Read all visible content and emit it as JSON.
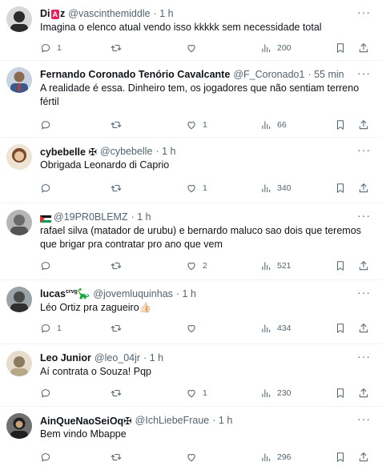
{
  "tweets": [
    {
      "name_pre": "Di",
      "name_badge": "A",
      "name_post": "z",
      "handle": "@vascinthemiddle",
      "time": "· 1 h",
      "text": "Imagina o elenco atual vendo isso kkkkk sem necessidade total",
      "replies": "1",
      "retweets": "",
      "likes": "",
      "views": "200",
      "avatar_color": "#2b2b2b"
    },
    {
      "name": "Fernando Coronado Tenório Cavalcante",
      "handle": "@F_Coronado1",
      "time": "· 55 min",
      "text": "A realidade é essa. Dinheiro tem, os jogadores que não sentiam terreno fértil",
      "replies": "",
      "retweets": "",
      "likes": "1",
      "views": "66",
      "avatar_color": "#3a5a8c"
    },
    {
      "name": "cybebelle ✠",
      "handle": "@cybebelle",
      "time": "· 1 h",
      "text": "Obrigada Leonardo di Caprio",
      "replies": "",
      "retweets": "",
      "likes": "1",
      "views": "340",
      "avatar_color": "#c9a27a"
    },
    {
      "name": "",
      "handle": "@19PR0BLEMZ",
      "time": "· 1 h",
      "text": "rafael silva (matador de urubu) e bernardo maluco sao dois que teremos que brigar pra contratar pro ano que vem",
      "replies": "",
      "retweets": "",
      "likes": "2",
      "views": "521",
      "avatar_color": "#6b6b6b"
    },
    {
      "name": "lucas",
      "name_sup": "crvg",
      "name_emoji": "🦕",
      "handle": "@jovemluquinhas",
      "time": "· 1 h",
      "text": "Léo Ortiz pra zagueiro👍🏻",
      "replies": "1",
      "retweets": "",
      "likes": "",
      "views": "434",
      "avatar_color": "#4a4a4a"
    },
    {
      "name": "Leo Junior",
      "handle": "@leo_04jr",
      "time": "· 1 h",
      "text": "Aí contrata o Souza! Pqp",
      "replies": "",
      "retweets": "",
      "likes": "1",
      "views": "230",
      "avatar_color": "#8a7a60"
    },
    {
      "name": "AinQueNaoSeiOq✠",
      "handle": "@IchLiebeFraue",
      "time": "· 1 h",
      "text": "Bem vindo Mbappe",
      "replies": "",
      "retweets": "",
      "likes": "",
      "views": "296",
      "avatar_color": "#1f1f1f"
    }
  ],
  "icons": {
    "reply": "reply-icon",
    "retweet": "retweet-icon",
    "like": "heart-icon",
    "views": "views-icon",
    "bookmark": "bookmark-icon",
    "share": "share-icon",
    "more": "more-icon"
  },
  "colors": {
    "text": "#0f1419",
    "secondary": "#536471",
    "divider": "#eff3f4",
    "badge": "#e0245e"
  }
}
